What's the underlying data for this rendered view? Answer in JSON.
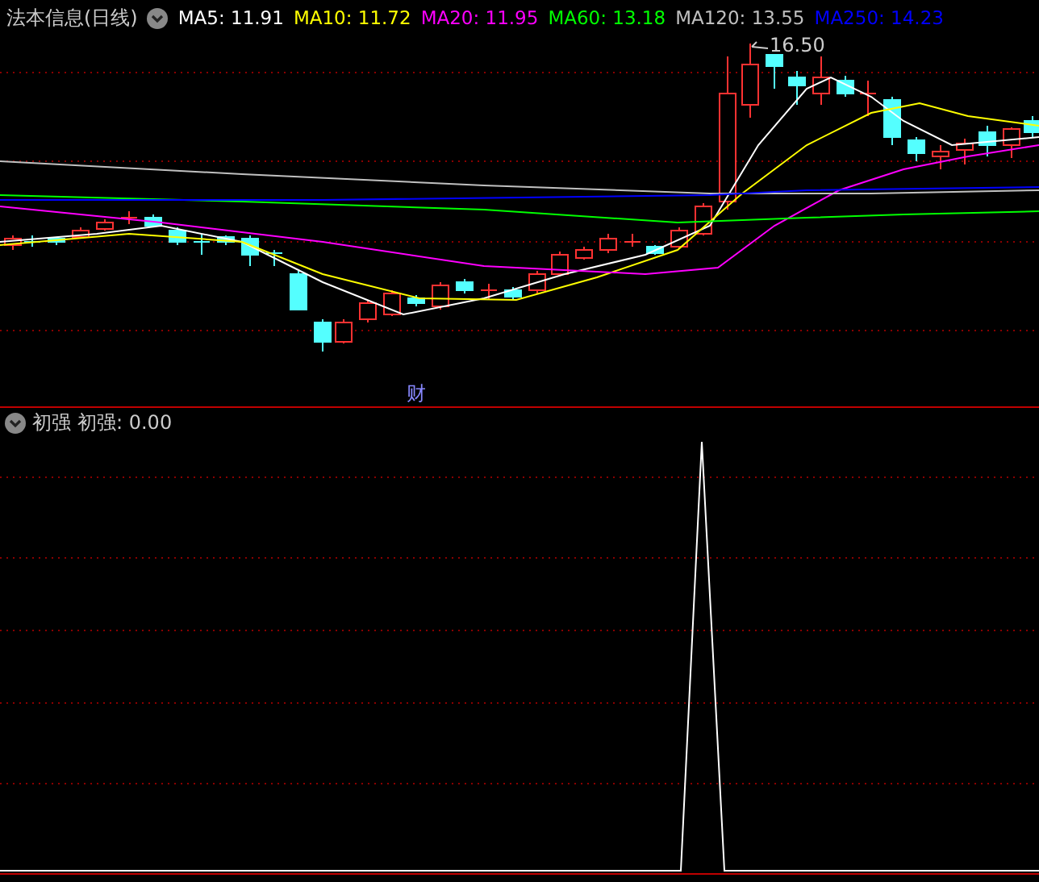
{
  "title": "法本信息(日线)",
  "moving_averages": [
    {
      "label": "MA5:",
      "value": "11.91",
      "color": "#ffffff"
    },
    {
      "label": "MA10:",
      "value": "11.72",
      "color": "#ffff00"
    },
    {
      "label": "MA20:",
      "value": "11.95",
      "color": "#ff00ff"
    },
    {
      "label": "MA60:",
      "value": "13.18",
      "color": "#00ff00"
    },
    {
      "label": "MA120:",
      "value": "13.55",
      "color": "#c0c0c0"
    },
    {
      "label": "MA250:",
      "value": "14.23",
      "color": "#0000ff"
    }
  ],
  "high_label": "16.50",
  "event_marker": "财",
  "indicator": {
    "name": "初强",
    "reading": "初强: 0.00"
  }
}
